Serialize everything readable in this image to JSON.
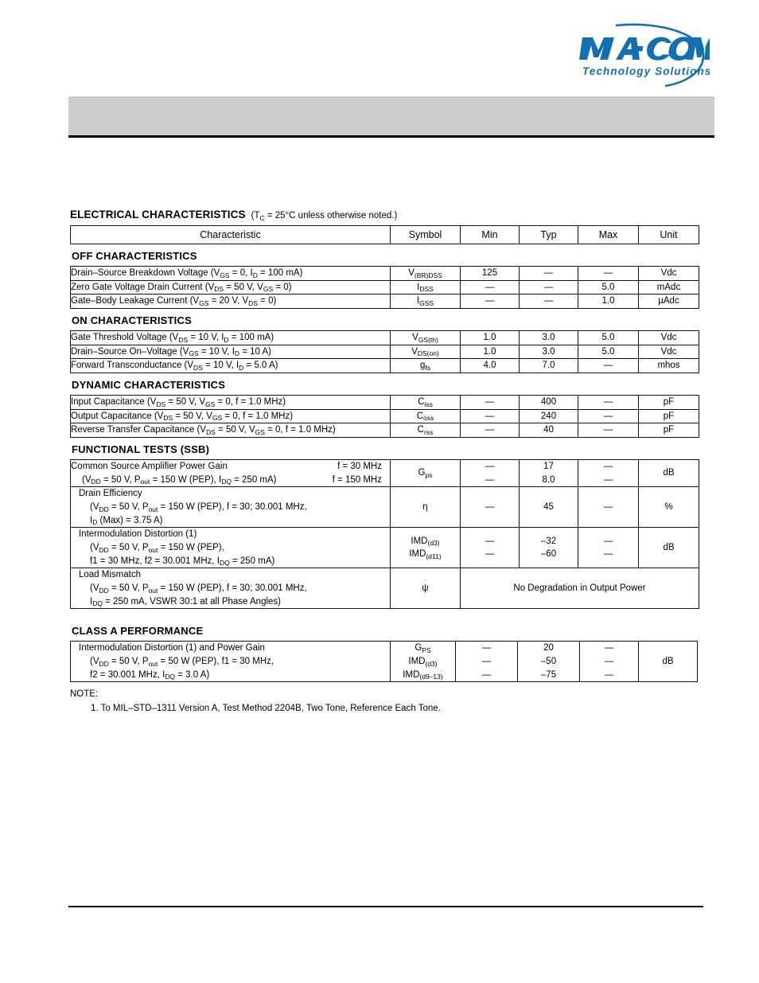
{
  "brand": {
    "logo_name": "macom-logo",
    "wordmark": "MACOM",
    "tagline": "Technology Solutions",
    "color": "#1270b0"
  },
  "header": {
    "band_color": "#cccccc"
  },
  "document": {
    "section_heading": "ELECTRICAL CHARACTERISTICS",
    "section_condition": "(T",
    "section_condition_sub": "C",
    "section_condition_rest": " = 25°C unless otherwise noted.)"
  },
  "table": {
    "columns": [
      "Characteristic",
      "Symbol",
      "Min",
      "Typ",
      "Max",
      "Unit"
    ],
    "groups": [
      {
        "title": "OFF CHARACTERISTICS",
        "rows": [
          {
            "characteristic": "Drain–Source Breakdown Voltage (V",
            "char_sub1": "GS",
            "char_mid": " = 0, I",
            "char_sub2": "D",
            "char_end": " = 100 mA)",
            "symbol": "V",
            "symbol_sub": "(BR)DSS",
            "min": "125",
            "typ": "—",
            "max": "—",
            "unit": "Vdc"
          },
          {
            "characteristic": "Zero Gate Voltage Drain Current (V",
            "char_sub1": "DS",
            "char_mid": " = 50 V, V",
            "char_sub2": "GS",
            "char_end": " = 0)",
            "symbol": "I",
            "symbol_sub": "DSS",
            "min": "—",
            "typ": "—",
            "max": "5.0",
            "unit": "mAdc"
          },
          {
            "characteristic": "Gate–Body Leakage Current (V",
            "char_sub1": "GS",
            "char_mid": " = 20 V, V",
            "char_sub2": "DS",
            "char_end": " = 0)",
            "symbol": "I",
            "symbol_sub": "GSS",
            "min": "—",
            "typ": "—",
            "max": "1.0",
            "unit": "µAdc"
          }
        ]
      },
      {
        "title": "ON CHARACTERISTICS",
        "rows": [
          {
            "characteristic": "Gate Threshold Voltage (V",
            "char_sub1": "DS",
            "char_mid": " = 10 V, I",
            "char_sub2": "D",
            "char_end": " = 100 mA)",
            "symbol": "V",
            "symbol_sub": "GS(th)",
            "min": "1.0",
            "typ": "3.0",
            "max": "5.0",
            "unit": "Vdc"
          },
          {
            "characteristic": "Drain–Source On–Voltage (V",
            "char_sub1": "GS",
            "char_mid": " = 10 V, I",
            "char_sub2": "D",
            "char_end": " = 10 A)",
            "symbol": "V",
            "symbol_sub": "DS(on)",
            "min": "1.0",
            "typ": "3.0",
            "max": "5.0",
            "unit": "Vdc"
          },
          {
            "characteristic": "Forward Transconductance (V",
            "char_sub1": "DS",
            "char_mid": " = 10 V, I",
            "char_sub2": "D",
            "char_end": " = 5.0 A)",
            "symbol": "g",
            "symbol_sub": "fs",
            "min": "4.0",
            "typ": "7.0",
            "max": "—",
            "unit": "mhos"
          }
        ]
      },
      {
        "title": "DYNAMIC CHARACTERISTICS",
        "rows": [
          {
            "characteristic": "Input Capacitance (V",
            "char_sub1": "DS",
            "char_mid": " = 50 V, V",
            "char_sub2": "GS",
            "char_end": " = 0, f = 1.0 MHz)",
            "symbol": "C",
            "symbol_sub": "iss",
            "min": "—",
            "typ": "400",
            "max": "—",
            "unit": "pF"
          },
          {
            "characteristic": "Output Capacitance (V",
            "char_sub1": "DS",
            "char_mid": " = 50 V, V",
            "char_sub2": "GS",
            "char_end": " = 0, f = 1.0 MHz)",
            "symbol": "C",
            "symbol_sub": "oss",
            "min": "—",
            "typ": "240",
            "max": "—",
            "unit": "pF"
          },
          {
            "characteristic": "Reverse Transfer Capacitance (V",
            "char_sub1": "DS",
            "char_mid": " = 50 V, V",
            "char_sub2": "GS",
            "char_end": " = 0, f = 1.0 MHz)",
            "symbol": "C",
            "symbol_sub": "rss",
            "min": "—",
            "typ": "40",
            "max": "—",
            "unit": "pF"
          }
        ]
      }
    ],
    "functional": {
      "title": "FUNCTIONAL TESTS (SSB)",
      "rows": {
        "gain": {
          "line1": "Common Source Amplifier Power Gain",
          "line1_right": "f = 30 MHz",
          "line2_a": "(V",
          "line2_a_sub": "DD",
          "line2_b": " = 50 V, P",
          "line2_b_sub": "out",
          "line2_c": " = 150 W (PEP), I",
          "line2_c_sub": "DQ",
          "line2_d": " = 250 mA)",
          "line2_right": "f = 150 MHz",
          "symbol": "G",
          "symbol_sub": "ps",
          "min1": "—",
          "min2": "—",
          "typ1": "17",
          "typ2": "8.0",
          "max1": "—",
          "max2": "—",
          "unit": "dB"
        },
        "efficiency": {
          "line1": "Drain Efficiency",
          "line2_a": "(V",
          "line2_a_sub": "DD",
          "line2_b": " = 50 V, P",
          "line2_b_sub": "out",
          "line2_c": " = 150 W (PEP), f = 30; 30.001 MHz,",
          "line3_a": "I",
          "line3_a_sub": "D",
          "line3_b": " (Max) = 3.75 A)",
          "symbol": "η",
          "min": "—",
          "typ": "45",
          "max": "—",
          "unit": "%"
        },
        "imd": {
          "line1": "Intermodulation Distortion (1)",
          "line2_a": "(V",
          "line2_a_sub": "DD",
          "line2_b": " = 50 V, P",
          "line2_b_sub": "out",
          "line2_c": " = 150 W (PEP),",
          "line3_a": "f1 = 30 MHz, f2 = 30.001 MHz, I",
          "line3_a_sub": "DQ",
          "line3_b": " = 250 mA)",
          "symbol1": "IMD",
          "symbol1_sub": "(d3)",
          "symbol2": "IMD",
          "symbol2_sub": "(d11)",
          "min1": "—",
          "min2": "—",
          "typ1": "–32",
          "typ2": "–60",
          "max1": "—",
          "max2": "—",
          "unit": "dB"
        },
        "mismatch": {
          "line1": "Load Mismatch",
          "line2_a": "(V",
          "line2_a_sub": "DD",
          "line2_b": " = 50 V, P",
          "line2_b_sub": "out",
          "line2_c": " = 150 W (PEP), f = 30; 30.001 MHz,",
          "line3_a": "I",
          "line3_a_sub": "DQ",
          "line3_b": " = 250 mA, VSWR 30:1 at all Phase Angles)",
          "symbol": "ψ",
          "spanned_value": "No Degradation in Output Power"
        }
      }
    },
    "class_a": {
      "title": "CLASS A PERFORMANCE",
      "row": {
        "line1": "Intermodulation Distortion (1) and Power Gain",
        "line2_a": "(V",
        "line2_a_sub": "DD",
        "line2_b": " = 50 V, P",
        "line2_b_sub": "out",
        "line2_c": " = 50 W (PEP), f1 = 30 MHz,",
        "line3_a": "f2 = 30.001 MHz, I",
        "line3_a_sub": "DQ",
        "line3_b": " = 3.0 A)",
        "symbol1": "G",
        "symbol1_sub": "PS",
        "symbol2": "IMD",
        "symbol2_sub": "(d3)",
        "symbol3": "IMD",
        "symbol3_sub": "(d9–13)",
        "min1": "—",
        "min2": "—",
        "min3": "—",
        "typ1": "20",
        "typ2": "–50",
        "typ3": "–75",
        "max1": "—",
        "max2": "—",
        "max3": "—",
        "unit": "dB"
      }
    }
  },
  "note": {
    "label": "NOTE:",
    "item1": "1. To MIL–STD–1311 Version A, Test Method 2204B, Two Tone, Reference Each Tone."
  }
}
